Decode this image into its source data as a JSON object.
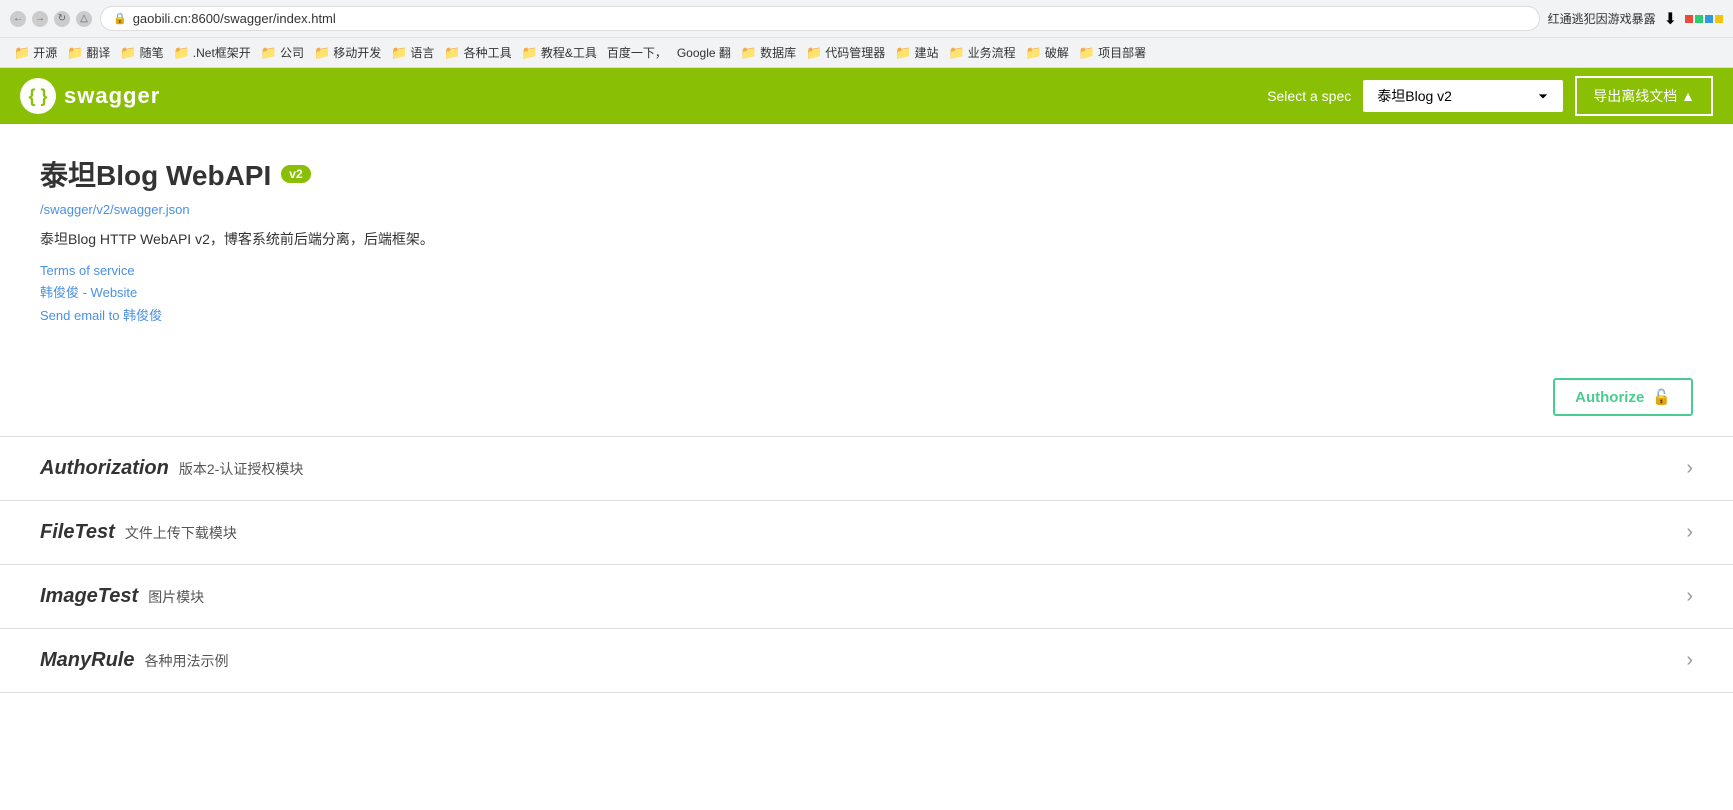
{
  "browser": {
    "url": "gaobili.cn:8600/swagger/index.html",
    "lock_icon": "🔒",
    "bookmarks": [
      {
        "label": "开源",
        "folder": true
      },
      {
        "label": "翻译",
        "folder": true
      },
      {
        "label": "随笔",
        "folder": true
      },
      {
        "label": ".Net框架开",
        "folder": true
      },
      {
        "label": "公司",
        "folder": true
      },
      {
        "label": "移动开发",
        "folder": true
      },
      {
        "label": "语言",
        "folder": true
      },
      {
        "label": "各种工具",
        "folder": true
      },
      {
        "label": "教程&工具",
        "folder": true
      },
      {
        "label": "百度一下，",
        "folder": false
      },
      {
        "label": "Google 翻",
        "folder": false
      },
      {
        "label": "数据库",
        "folder": true
      },
      {
        "label": "代码管理器",
        "folder": true
      },
      {
        "label": "建站",
        "folder": true
      },
      {
        "label": "业务流程",
        "folder": true
      },
      {
        "label": "破解",
        "folder": true
      },
      {
        "label": "项目部署",
        "folder": true
      }
    ],
    "top_right_text": "红通逃犯因游戏暴露"
  },
  "swagger": {
    "icon_text": "{ }",
    "brand": "swagger",
    "select_spec_label": "Select a spec",
    "spec_value": "泰坦Blog v2",
    "export_btn_label": "导出离线文档 ▲"
  },
  "api": {
    "title": "泰坦Blog WebAPI",
    "version": "v2",
    "spec_link": "/swagger/v2/swagger.json",
    "description": "泰坦Blog HTTP WebAPI v2，博客系统前后端分离，后端框架。",
    "links": {
      "terms": "Terms of service",
      "website": "韩俊俊 - Website",
      "email": "Send email to 韩俊俊"
    },
    "authorize_btn": "Authorize",
    "authorize_icon": "🔓"
  },
  "sections": [
    {
      "name": "Authorization",
      "desc": "版本2-认证授权模块"
    },
    {
      "name": "FileTest",
      "desc": "文件上传下载模块"
    },
    {
      "name": "ImageTest",
      "desc": "图片模块"
    },
    {
      "name": "ManyRule",
      "desc": "各种用法示例"
    }
  ]
}
